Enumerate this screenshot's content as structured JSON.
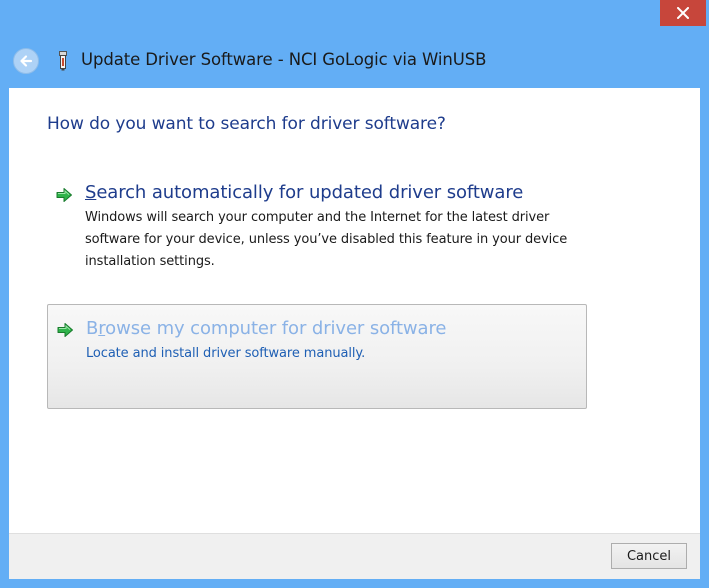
{
  "window": {
    "title": "Update Driver Software - NCI GoLogic via WinUSB",
    "close_icon": "close-icon",
    "back_icon": "back-arrow-icon",
    "device_icon": "usb-device-icon"
  },
  "content": {
    "question": "How do you want to search for driver software?",
    "options": [
      {
        "access_key": "S",
        "title_rest": "earch automatically for updated driver software",
        "description": "Windows will search your computer and the Internet for the latest driver software for your device, unless you’ve disabled this feature in your device installation settings.",
        "icon": "green-arrow-icon"
      },
      {
        "title_start": "B",
        "access_key": "r",
        "title_rest": "owse my computer for driver software",
        "description": "Locate and install driver software manually.",
        "icon": "green-arrow-icon"
      }
    ]
  },
  "footer": {
    "cancel_label": "Cancel"
  },
  "colors": {
    "frame": "#63aef5",
    "close_button": "#c7463b",
    "heading_blue": "#1e3c8c",
    "highlight_title": "#8ab2e6",
    "link_desc": "#1e5fb4"
  }
}
